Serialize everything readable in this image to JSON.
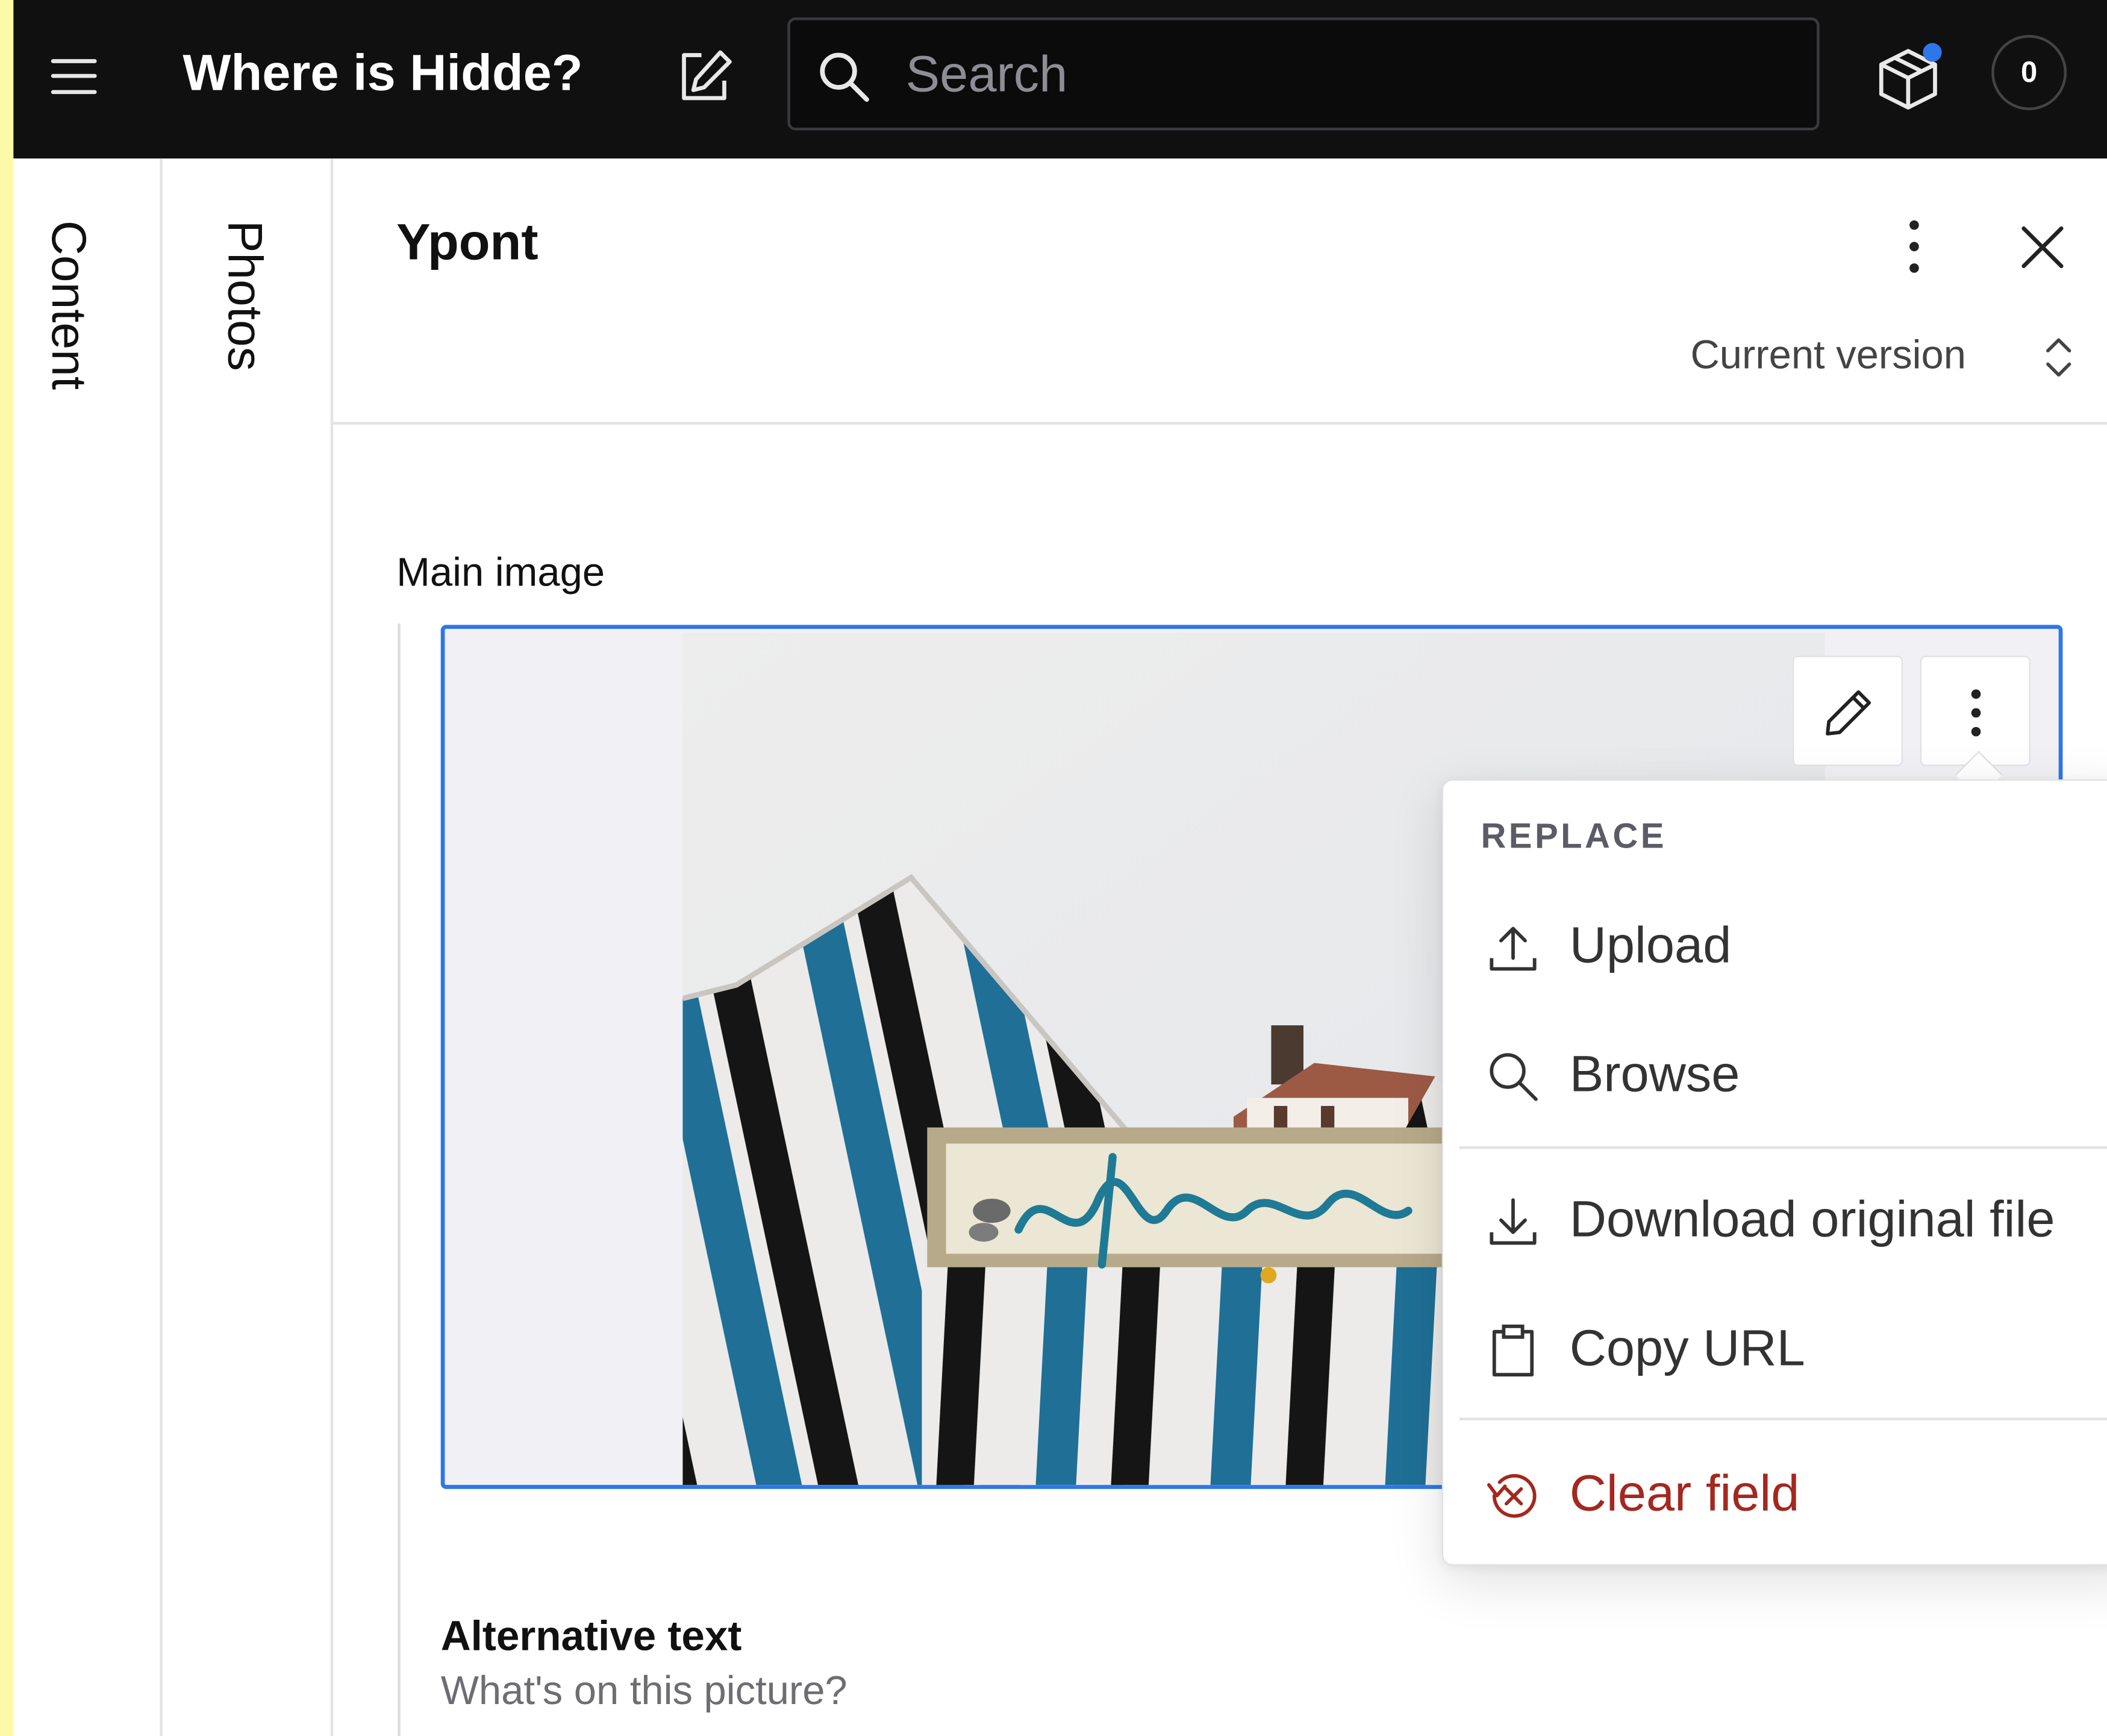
{
  "topbar": {
    "app_title": "Where is Hidde?",
    "search_placeholder": "Search",
    "notification_count": "0"
  },
  "nav": {
    "column_1": "Content",
    "column_2": "Photos"
  },
  "document": {
    "title": "Ypont",
    "version_label": "Current version"
  },
  "fields": {
    "main_image_label": "Main image",
    "alt_text_label": "Alternative text",
    "alt_text_description": "What's on this picture?"
  },
  "image_menu": {
    "section_header": "REPLACE",
    "items": [
      {
        "label": "Upload",
        "icon": "upload-icon"
      },
      {
        "label": "Browse",
        "icon": "search-icon"
      },
      {
        "label": "Download original file",
        "icon": "download-icon"
      },
      {
        "label": "Copy URL",
        "icon": "clipboard-icon"
      },
      {
        "label": "Clear field",
        "icon": "reset-icon",
        "tone": "critical"
      }
    ]
  },
  "colors": {
    "topbar_bg": "#101011",
    "focus_blue": "#2f76e8",
    "critical_red": "#a3281f",
    "notification_dot": "#2f76e8",
    "stripe_blue": "#1f6f96"
  }
}
